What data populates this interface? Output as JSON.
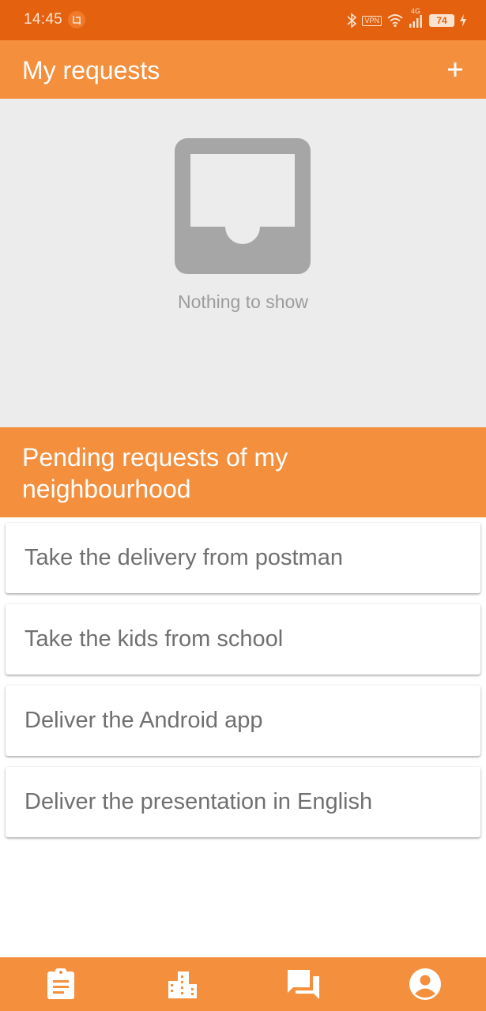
{
  "status_bar": {
    "time": "14:45",
    "vpn": "VPN",
    "network": "4G",
    "battery": "74",
    "icons": [
      "notification-icon",
      "bluetooth-icon",
      "vpn-icon",
      "wifi-icon",
      "signal-icon",
      "battery-icon",
      "charging-icon"
    ]
  },
  "app_bar": {
    "title": "My requests",
    "add_icon": "plus-icon"
  },
  "empty_state": {
    "icon": "inbox-icon",
    "text": "Nothing to show"
  },
  "section": {
    "title": "Pending requests of my neighbourhood"
  },
  "requests": [
    {
      "title": "Take the delivery from postman"
    },
    {
      "title": "Take the kids from school"
    },
    {
      "title": "Deliver the Android app"
    },
    {
      "title": "Deliver the presentation in English"
    }
  ],
  "bottom_nav": {
    "items": [
      {
        "icon": "assignment-icon"
      },
      {
        "icon": "city-icon"
      },
      {
        "icon": "forum-icon"
      },
      {
        "icon": "account-circle-icon"
      }
    ]
  },
  "colors": {
    "status_bar": "#e4620f",
    "primary": "#f38f3d",
    "empty_background": "#ececec",
    "empty_icon": "#a6a6a6",
    "text_secondary": "#707070"
  }
}
